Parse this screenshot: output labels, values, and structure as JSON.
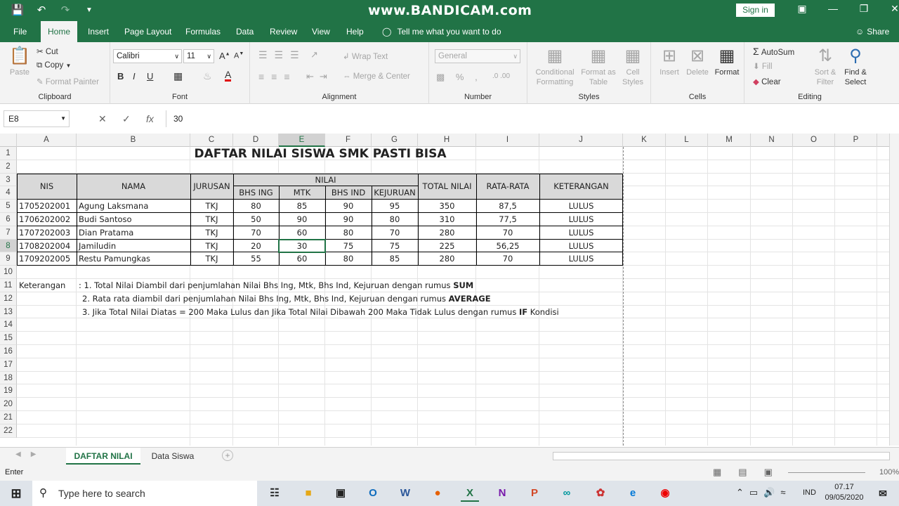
{
  "titlebar": {
    "watermark": "www.BANDICAM.com",
    "signin": "Sign in"
  },
  "tabs": [
    "File",
    "Home",
    "Insert",
    "Page Layout",
    "Formulas",
    "Data",
    "Review",
    "View",
    "Help"
  ],
  "tell_me": "Tell me what you want to do",
  "share": "Share",
  "ribbon": {
    "clipboard": {
      "label": "Clipboard",
      "paste": "Paste",
      "cut": "Cut",
      "copy": "Copy",
      "format_painter": "Format Painter"
    },
    "font": {
      "label": "Font",
      "name": "Calibri",
      "size": "11"
    },
    "alignment": {
      "label": "Alignment",
      "wrap": "Wrap Text",
      "merge": "Merge & Center"
    },
    "number": {
      "label": "Number",
      "format": "General"
    },
    "styles": {
      "label": "Styles",
      "conditional": "Conditional Formatting",
      "format_table": "Format as Table",
      "cell_styles": "Cell Styles"
    },
    "cells": {
      "label": "Cells",
      "insert": "Insert",
      "delete": "Delete",
      "format": "Format"
    },
    "editing": {
      "label": "Editing",
      "autosum": "AutoSum",
      "fill": "Fill",
      "clear": "Clear",
      "sort": "Sort & Filter",
      "find": "Find & Select"
    }
  },
  "formula_bar": {
    "name_box": "E8",
    "value": "30"
  },
  "columns": [
    "A",
    "B",
    "C",
    "D",
    "E",
    "F",
    "G",
    "H",
    "I",
    "J",
    "K",
    "L",
    "M",
    "N",
    "O",
    "P"
  ],
  "rows": [
    "1",
    "2",
    "3",
    "4",
    "5",
    "6",
    "7",
    "8",
    "9",
    "10",
    "11",
    "12",
    "13",
    "14",
    "15",
    "16",
    "17",
    "18",
    "19",
    "20",
    "21",
    "22"
  ],
  "sheet": {
    "title": "DAFTAR NILAI SISWA SMK PASTI BISA",
    "headers": {
      "nis": "NIS",
      "nama": "NAMA",
      "jurusan": "JURUSAN",
      "nilai": "NILAI",
      "bhs_ing": "BHS ING",
      "mtk": "MTK",
      "bhs_ind": "BHS IND",
      "kejuruan": "KEJURUAN",
      "total": "TOTAL NILAI",
      "rata": "RATA-RATA",
      "ket": "KETERANGAN"
    },
    "data": [
      [
        "1705202001",
        "Agung Laksmana",
        "TKJ",
        "80",
        "85",
        "90",
        "95",
        "350",
        "87,5",
        "LULUS"
      ],
      [
        "1706202002",
        "Budi Santoso",
        "TKJ",
        "50",
        "90",
        "90",
        "80",
        "310",
        "77,5",
        "LULUS"
      ],
      [
        "1707202003",
        "Dian Pratama",
        "TKJ",
        "70",
        "60",
        "80",
        "70",
        "280",
        "70",
        "LULUS"
      ],
      [
        "1708202004",
        "Jamiludin",
        "TKJ",
        "20",
        "30",
        "75",
        "75",
        "225",
        "56,25",
        "LULUS"
      ],
      [
        "1709202005",
        "Restu Pamungkas",
        "TKJ",
        "55",
        "60",
        "80",
        "85",
        "280",
        "70",
        "LULUS"
      ]
    ],
    "notes_label": "Keterangan",
    "notes": [
      {
        "text": ": 1. Total Nilai Diambil dari penjumlahan Nilai Bhs Ing, Mtk, Bhs Ind, Kejuruan dengan rumus ",
        "bold": "SUM",
        "after": ""
      },
      {
        "text": "2. Rata rata diambil dari penjumlahan Nilai Bhs Ing, Mtk, Bhs Ind, Kejuruan dengan rumus ",
        "bold": "AVERAGE",
        "after": ""
      },
      {
        "text": "3. Jika Total Nilai Diatas = 200 Maka Lulus dan Jika Total Nilai Dibawah 200 Maka Tidak Lulus dengan rumus ",
        "bold": "IF",
        "after": " Kondisi"
      }
    ]
  },
  "sheet_tabs": [
    "DAFTAR NILAI",
    "Data Siswa"
  ],
  "status": {
    "mode": "Enter",
    "zoom": "100%"
  },
  "taskbar": {
    "search": "Type here to search",
    "time": "07.17",
    "date": "09/05/2020",
    "lang": "IND"
  }
}
